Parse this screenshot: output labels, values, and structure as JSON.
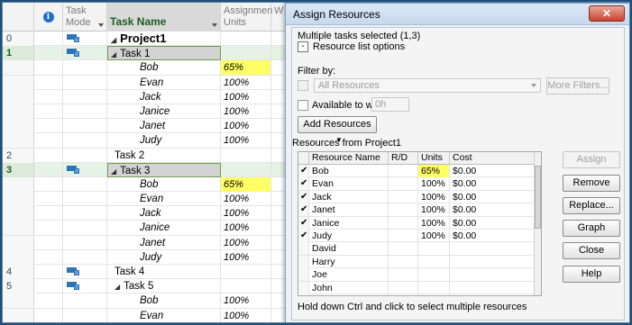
{
  "grid": {
    "headers": {
      "info": "i",
      "task_mode_line1": "Task",
      "task_mode_line2": "Mode",
      "task_name": "Task Name",
      "assignment_units_line1": "Assignmen",
      "assignment_units_line2": "Units",
      "extra": "W"
    },
    "rows": [
      {
        "id": "0",
        "mode": true,
        "name": "Project1",
        "units": "",
        "kind": "project",
        "expand": "◢"
      },
      {
        "id": "1",
        "mode": true,
        "name": "Task 1",
        "units": "",
        "kind": "summary",
        "expand": "◢",
        "selected": true
      },
      {
        "id": "",
        "mode": false,
        "name": "Bob",
        "units": "65%",
        "kind": "res",
        "hl": true
      },
      {
        "id": "",
        "mode": false,
        "name": "Evan",
        "units": "100%",
        "kind": "res"
      },
      {
        "id": "",
        "mode": false,
        "name": "Jack",
        "units": "100%",
        "kind": "res"
      },
      {
        "id": "",
        "mode": false,
        "name": "Janice",
        "units": "100%",
        "kind": "res"
      },
      {
        "id": "",
        "mode": false,
        "name": "Janet",
        "units": "100%",
        "kind": "res"
      },
      {
        "id": "",
        "mode": false,
        "name": "Judy",
        "units": "100%",
        "kind": "res"
      },
      {
        "id": "2",
        "mode": false,
        "name": "Task 2",
        "units": "",
        "kind": "task"
      },
      {
        "id": "3",
        "mode": true,
        "name": "Task 3",
        "units": "",
        "kind": "summary",
        "expand": "◢",
        "selected": true
      },
      {
        "id": "",
        "mode": false,
        "name": "Bob",
        "units": "65%",
        "kind": "res",
        "hl": true
      },
      {
        "id": "",
        "mode": false,
        "name": "Evan",
        "units": "100%",
        "kind": "res"
      },
      {
        "id": "",
        "mode": false,
        "name": "Jack",
        "units": "100%",
        "kind": "res"
      },
      {
        "id": "",
        "mode": false,
        "name": "Janice",
        "units": "100%",
        "kind": "res"
      },
      {
        "id": "",
        "mode": false,
        "name": "Janet",
        "units": "100%",
        "kind": "res"
      },
      {
        "id": "",
        "mode": false,
        "name": "Judy",
        "units": "100%",
        "kind": "res"
      },
      {
        "id": "4",
        "mode": true,
        "name": "Task 4",
        "units": "",
        "kind": "task"
      },
      {
        "id": "5",
        "mode": true,
        "name": "Task 5",
        "units": "",
        "kind": "task",
        "expand": "◢"
      },
      {
        "id": "",
        "mode": false,
        "name": "Bob",
        "units": "100%",
        "kind": "res"
      },
      {
        "id": "",
        "mode": false,
        "name": "Evan",
        "units": "100%",
        "kind": "res"
      }
    ]
  },
  "dialog": {
    "title": "Assign Resources",
    "close_glyph": "✕",
    "tasks_selected": "Multiple tasks selected (1,3)",
    "collapse_glyph": "-",
    "resource_list_options": "Resource list options",
    "filter_by_label": "Filter by:",
    "filter_value": "All Resources",
    "more_filters": "More Filters...",
    "available_to_work_label": "Available to work",
    "available_hours": "0h",
    "add_resources": "Add Resources",
    "resources_from": "Resources from Project1",
    "table_headers": {
      "name": "Resource Name",
      "rd": "R/D",
      "units": "Units",
      "cost": "Cost"
    },
    "resources": [
      {
        "check": "✔",
        "name": "Bob",
        "units": "65%",
        "cost": "$0.00",
        "hl": true
      },
      {
        "check": "✔",
        "name": "Evan",
        "units": "100%",
        "cost": "$0.00"
      },
      {
        "check": "✔",
        "name": "Jack",
        "units": "100%",
        "cost": "$0.00"
      },
      {
        "check": "✔",
        "name": "Janet",
        "units": "100%",
        "cost": "$0.00"
      },
      {
        "check": "✔",
        "name": "Janice",
        "units": "100%",
        "cost": "$0.00"
      },
      {
        "check": "✔",
        "name": "Judy",
        "units": "100%",
        "cost": "$0.00"
      },
      {
        "check": "",
        "name": "David",
        "units": "",
        "cost": ""
      },
      {
        "check": "",
        "name": "Harry",
        "units": "",
        "cost": ""
      },
      {
        "check": "",
        "name": "Joe",
        "units": "",
        "cost": ""
      },
      {
        "check": "",
        "name": "John",
        "units": "",
        "cost": ""
      }
    ],
    "buttons": {
      "assign": "Assign",
      "remove": "Remove",
      "replace": "Replace...",
      "graph": "Graph",
      "close": "Close",
      "help": "Help"
    },
    "hint": "Hold down Ctrl and click to select multiple resources"
  }
}
